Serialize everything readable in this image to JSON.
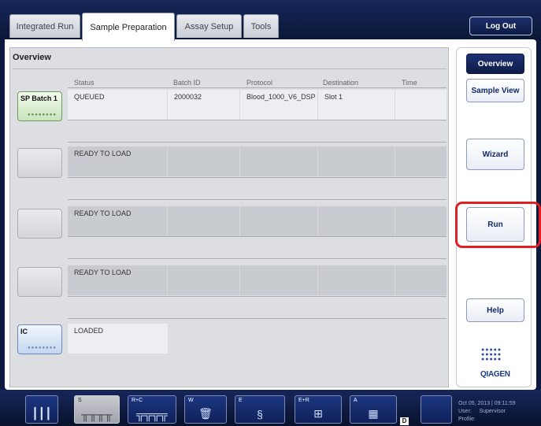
{
  "tabs": [
    {
      "label": "Integrated Run",
      "active": false
    },
    {
      "label": "Sample Preparation",
      "active": true
    },
    {
      "label": "Assay Setup",
      "active": false
    },
    {
      "label": "Tools",
      "active": false
    }
  ],
  "logout_label": "Log Out",
  "overview": {
    "title": "Overview",
    "columns": [
      "Status",
      "Batch ID",
      "Protocol",
      "Destination",
      "Time"
    ],
    "rows": [
      {
        "slot_label": "SP Batch 1",
        "status": "QUEUED",
        "batch_id": "2000032",
        "protocol": "Blood_1000_V6_DSP",
        "destination": "Slot 1",
        "time": ""
      },
      {
        "slot_label": "",
        "status": "READY TO LOAD",
        "batch_id": "",
        "protocol": "",
        "destination": "",
        "time": ""
      },
      {
        "slot_label": "",
        "status": "READY TO LOAD",
        "batch_id": "",
        "protocol": "",
        "destination": "",
        "time": ""
      },
      {
        "slot_label": "",
        "status": "READY TO LOAD",
        "batch_id": "",
        "protocol": "",
        "destination": "",
        "time": ""
      }
    ],
    "ic": {
      "slot_label": "IC",
      "status": "LOADED"
    }
  },
  "nav": {
    "overview": "Overview",
    "sample_view": "Sample View",
    "wizard": "Wizard",
    "run": "Run",
    "help": "Help"
  },
  "brand": "QIAGEN",
  "bottom": {
    "slots": [
      "S",
      "R+C",
      "W",
      "E",
      "E+R",
      "A"
    ],
    "d_badge": "D",
    "datetime": "Oct 05, 2013 | 09:11:59",
    "user_label": "User:",
    "user_value": "Supervisor",
    "profile_label": "Profile:"
  },
  "colors": {
    "highlight": "#e02020",
    "navy": "#0d1a3d"
  }
}
